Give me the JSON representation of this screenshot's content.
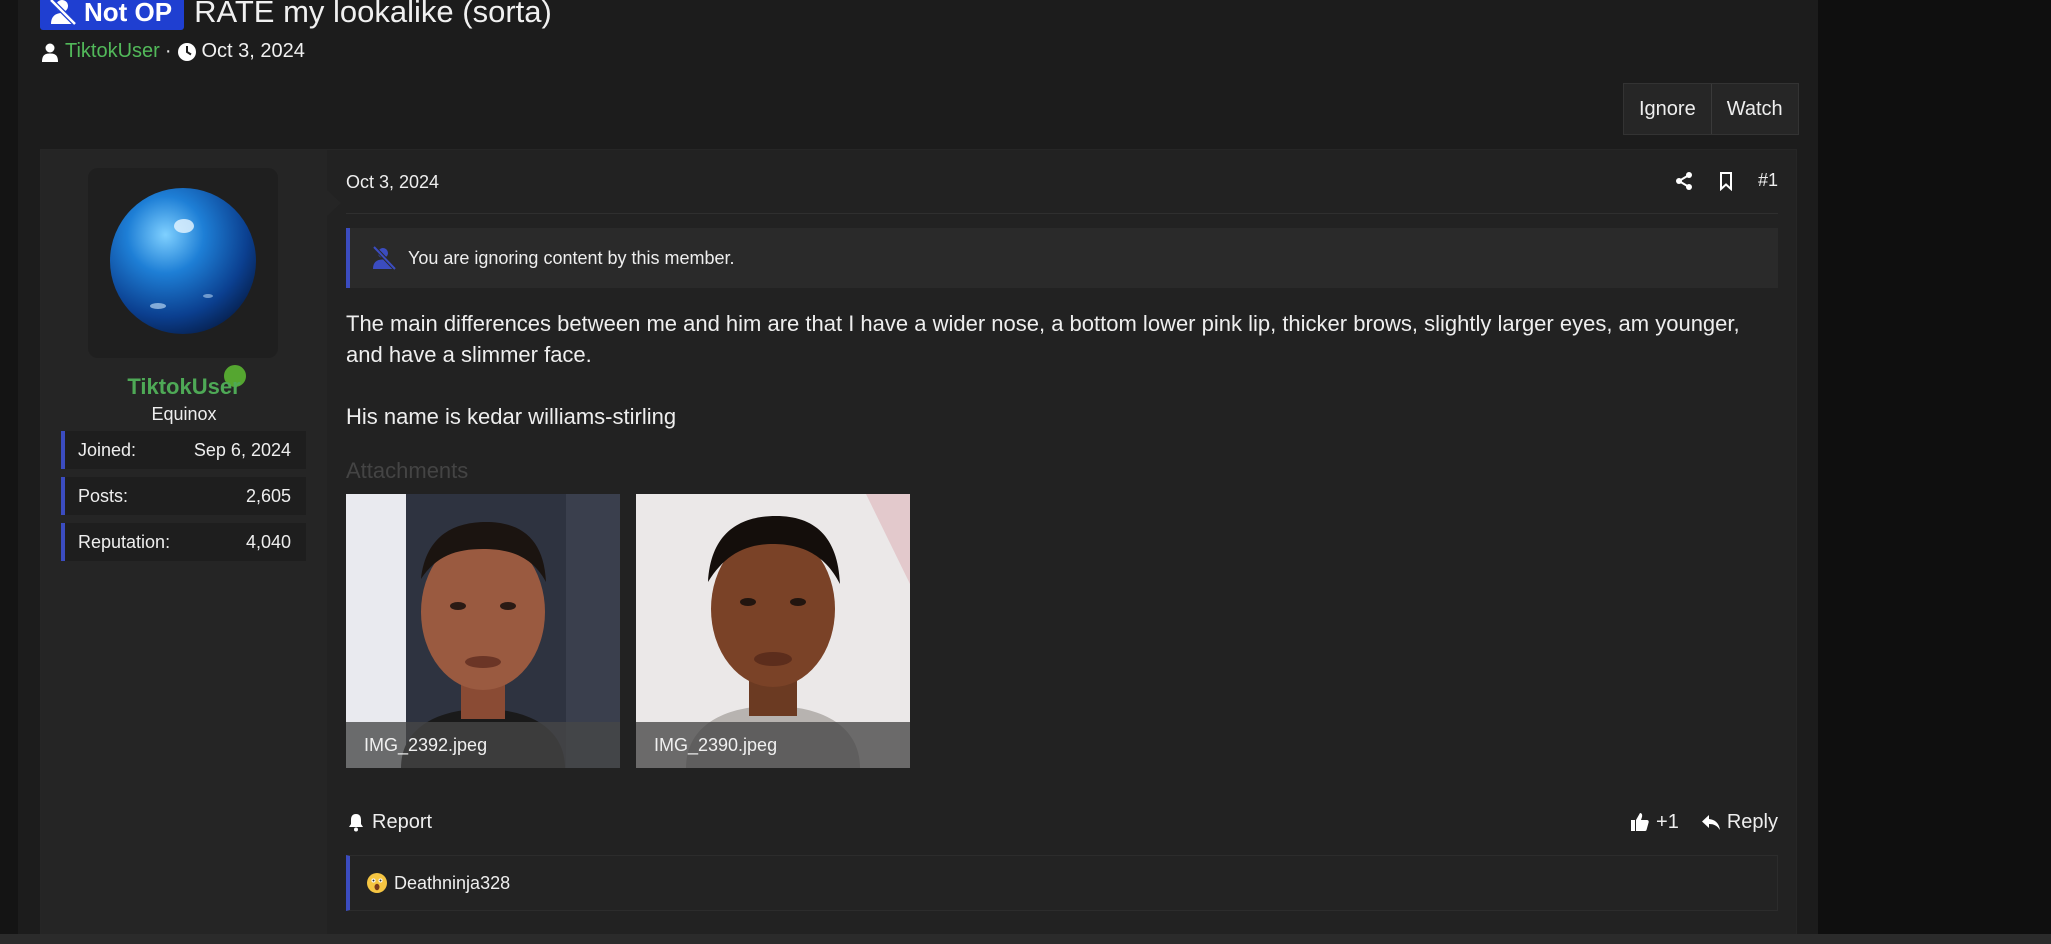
{
  "thread": {
    "prefix_label": "Not OP",
    "title": "RATE my lookalike (sorta)",
    "author": "TiktokUser",
    "separator": "·",
    "date": "Oct 3, 2024"
  },
  "thread_actions": {
    "ignore_label": "Ignore",
    "watch_label": "Watch"
  },
  "post": {
    "date": "Oct 3, 2024",
    "number": "#1",
    "ignore_notice": "You are ignoring content by this member.",
    "body": [
      "The main differences between me and him are that I have a wider nose, a bottom lower pink lip, thicker brows, slightly larger eyes, am younger, and have a slimmer face.",
      "His name is kedar williams-stirling"
    ],
    "attachments_label": "Attachments",
    "attachments": [
      {
        "name": "IMG_2392.jpeg"
      },
      {
        "name": "IMG_2390.jpeg"
      }
    ],
    "report_label": "Report",
    "reaction_count": "+1",
    "reply_label": "Reply",
    "reacted_by": "Deathninja328"
  },
  "user": {
    "name": "TiktokUser",
    "title": "Equinox",
    "stats": [
      {
        "label": "Joined:",
        "value": "Sep 6, 2024"
      },
      {
        "label": "Posts:",
        "value": "2,605"
      },
      {
        "label": "Reputation:",
        "value": "4,040"
      }
    ]
  },
  "colors": {
    "accent": "#3b4cc0",
    "username": "#4ea956",
    "badge": "#1f3fd1",
    "online": "#55a630"
  },
  "icons": [
    "user-slash-icon",
    "user-icon",
    "clock-icon",
    "share-icon",
    "bookmark-icon",
    "muted-user-icon",
    "bell-icon",
    "thumbs-up-icon",
    "reply-icon",
    "surprised-emoji-icon"
  ]
}
